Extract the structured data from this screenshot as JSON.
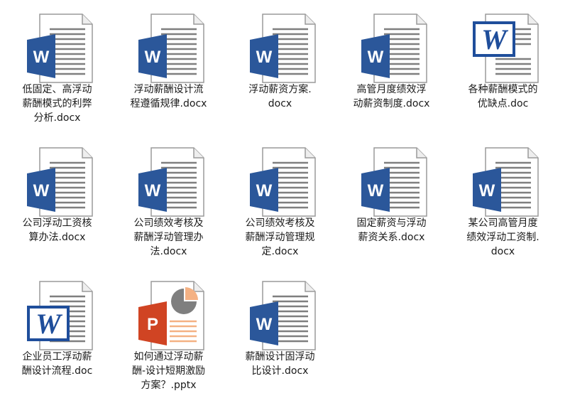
{
  "files": [
    {
      "name": "低固定、高浮动\n薪酬模式的利弊\n分析.docx",
      "icon": "word-icon"
    },
    {
      "name": "浮动薪酬设计流\n程遵循规律.docx",
      "icon": "word-icon"
    },
    {
      "name": "浮动薪资方案.\ndocx",
      "icon": "word-icon"
    },
    {
      "name": "高管月度绩效浮\n动薪资制度.docx",
      "icon": "word-icon"
    },
    {
      "name": "各种薪酬模式的\n优缺点.doc",
      "icon": "word-legacy-icon"
    },
    {
      "name": "公司浮动工资核\n算办法.docx",
      "icon": "word-icon"
    },
    {
      "name": "公司绩效考核及\n薪酬浮动管理办\n法.docx",
      "icon": "word-icon"
    },
    {
      "name": "公司绩效考核及\n薪酬浮动管理规\n定.docx",
      "icon": "word-icon"
    },
    {
      "name": "固定薪资与浮动\n薪资关系.docx",
      "icon": "word-icon"
    },
    {
      "name": "某公司高管月度\n绩效浮动工资制.\ndocx",
      "icon": "word-icon"
    },
    {
      "name": "企业员工浮动薪\n酬设计流程.doc",
      "icon": "word-legacy-icon"
    },
    {
      "name": "如何通过浮动薪\n酬-设计短期激励\n方案？.pptx",
      "icon": "powerpoint-icon"
    },
    {
      "name": "薪酬设计固浮动\n比设计.docx",
      "icon": "word-icon"
    }
  ],
  "icon_labels": {
    "word": "W",
    "powerpoint": "P"
  },
  "colors": {
    "word_blue": "#2b579a",
    "word_legacy_blue": "#1f4e9b",
    "powerpoint_orange": "#d04423",
    "powerpoint_light": "#f4b183",
    "page_lines": "#7f7f7f",
    "background": "#ffffff"
  }
}
